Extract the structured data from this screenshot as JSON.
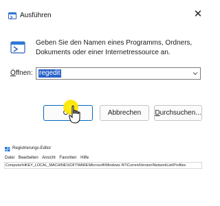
{
  "dialog": {
    "title": "Ausführen",
    "close_glyph": "✕",
    "description": "Geben Sie den Namen eines Programms, Ordners, Dokuments oder einer Internetressource an.",
    "open_label_underlined": "Ö",
    "open_label_rest": "ffnen:",
    "open_value": "regedit",
    "ok_label": "OK",
    "cancel_label": "Abbrechen",
    "browse_label_underlined": "D",
    "browse_label_rest": "urchsuchen...",
    "accent_color": "#0067c0",
    "selection_color": "#2a63c8"
  },
  "icons": {
    "title": "run-icon",
    "big": "run-icon",
    "close": "close-icon",
    "dropdown": "chevron-down-icon",
    "cursor": "hand-cursor-icon",
    "registry": "registry-editor-icon"
  },
  "registry_editor": {
    "title": "Registrierungs-Editor",
    "menu": [
      "Datei",
      "Bearbeiten",
      "Ansicht",
      "Favoriten",
      "Hilfe"
    ],
    "path": "Computer\\HKEY_LOCAL_MACHINE\\SOFTWARE\\Microsoft\\Windows NT\\CurrentVersion\\NetworkList\\Profiles"
  }
}
